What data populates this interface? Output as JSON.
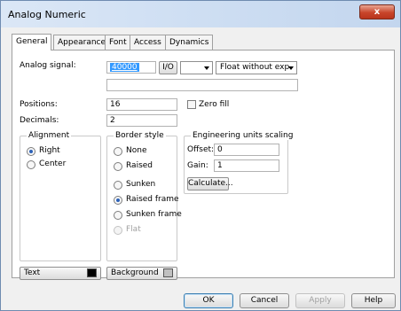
{
  "window": {
    "title": "Analog Numeric",
    "close_label": "x"
  },
  "tabs": [
    {
      "label": "General"
    },
    {
      "label": "Appearance"
    },
    {
      "label": "Font"
    },
    {
      "label": "Access"
    },
    {
      "label": "Dynamics"
    }
  ],
  "general": {
    "analog_signal_label": "Analog signal:",
    "analog_signal_value": "40000",
    "io_button": "I/O",
    "combo1_value": "",
    "format_combo_value": "Float without exp.",
    "positions_label": "Positions:",
    "positions_value": "16",
    "zero_fill_label": "Zero fill",
    "decimals_label": "Decimals:",
    "decimals_value": "2"
  },
  "alignment": {
    "title": "Alignment",
    "options": [
      {
        "label": "Right",
        "selected": true
      },
      {
        "label": "Center",
        "selected": false
      }
    ]
  },
  "border_style": {
    "title": "Border style",
    "options": [
      {
        "label": "None"
      },
      {
        "label": "Raised"
      },
      {
        "label": "Sunken"
      },
      {
        "label": "Raised frame"
      },
      {
        "label": "Sunken frame"
      },
      {
        "label": "Flat"
      }
    ],
    "selected": "Raised frame"
  },
  "scaling": {
    "title": "Engineering units scaling",
    "offset_label": "Offset:",
    "offset_value": "0",
    "gain_label": "Gain:",
    "gain_value": "1",
    "calculate_label": "Calculate..."
  },
  "colors": {
    "text_label": "Text",
    "text_color": "#000000",
    "background_label": "Background",
    "background_color": "#c0c0c0"
  },
  "buttons": {
    "ok": "OK",
    "cancel": "Cancel",
    "apply": "Apply",
    "help": "Help"
  }
}
